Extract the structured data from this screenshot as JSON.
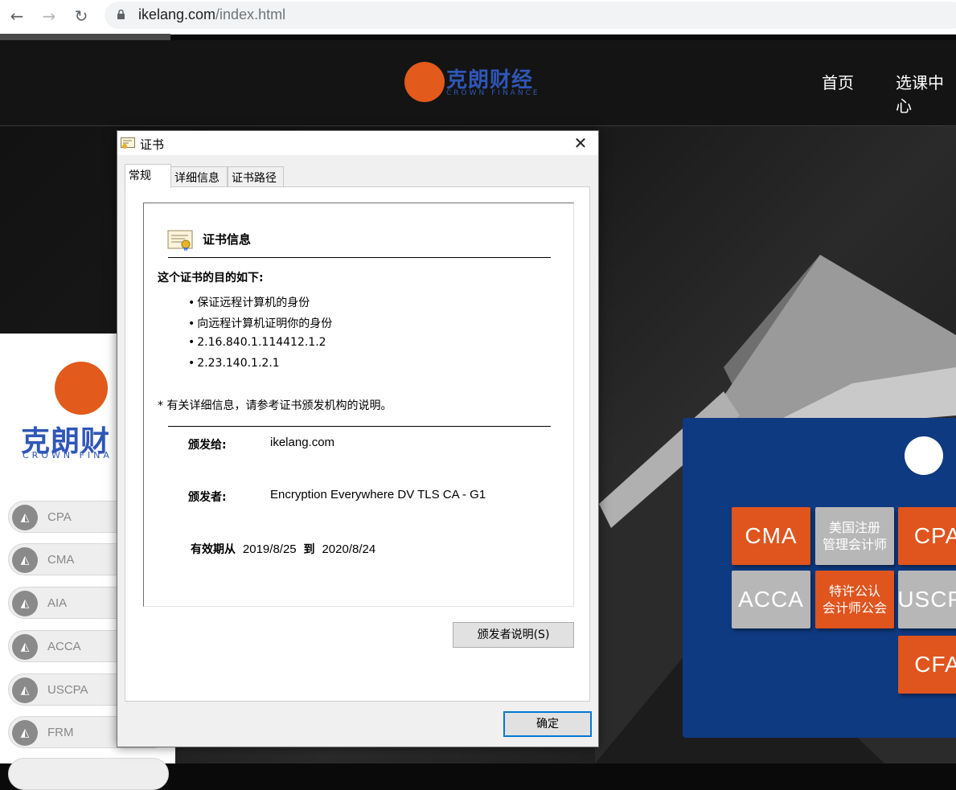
{
  "browser": {
    "back_icon": "arrow-left-icon",
    "forward_icon": "arrow-right-icon",
    "reload_icon": "reload-icon",
    "url_host": "ikelang.com",
    "url_path": "/index.html"
  },
  "site": {
    "logo_text": "克朗财经",
    "logo_sub": "CROWN FINANCE",
    "nav": [
      "首页",
      "选课中心"
    ],
    "left_logo_text": "克朗财",
    "left_logo_sub": "CROWN FINA",
    "courses": [
      "CPA",
      "CMA",
      "AIA",
      "ACCA",
      "USCPA",
      "FRM"
    ],
    "tiles": {
      "cma": "CMA",
      "cma_cn_1": "美国注册",
      "cma_cn_2": "管理会计师",
      "cpa": "CPA",
      "acca": "ACCA",
      "acca_cn_1": "特许公认",
      "acca_cn_2": "会计师公会",
      "uscpa": "USCPA",
      "cfa": "CFA"
    },
    "brand_orange": "#e25a1c",
    "brand_blue": "#2f57b7",
    "promo_blue": "#0e3a82"
  },
  "dialog": {
    "title": "证书",
    "close_icon": "close-icon",
    "tabs": [
      "常规",
      "详细信息",
      "证书路径"
    ],
    "active_tab": 0,
    "cert_heading": "证书信息",
    "purpose_heading": "这个证书的目的如下:",
    "purposes": [
      "保证远程计算机的身份",
      "向远程计算机证明你的身份",
      "2.16.840.1.114412.1.2",
      "2.23.140.1.2.1"
    ],
    "bullet": "•",
    "note": "* 有关详细信息，请参考证书颁发机构的说明。",
    "issued_to_label": "颁发给:",
    "issued_to_value": "ikelang.com",
    "issued_by_label": "颁发者:",
    "issued_by_value": "Encryption Everywhere DV TLS CA - G1",
    "valid_from_label": "有效期从",
    "valid_from": "2019/8/25",
    "valid_to_label": "到",
    "valid_to": "2020/8/24",
    "issuer_statement_button": "颁发者说明(S)",
    "ok_button": "确定",
    "accent": "#0078d7"
  }
}
